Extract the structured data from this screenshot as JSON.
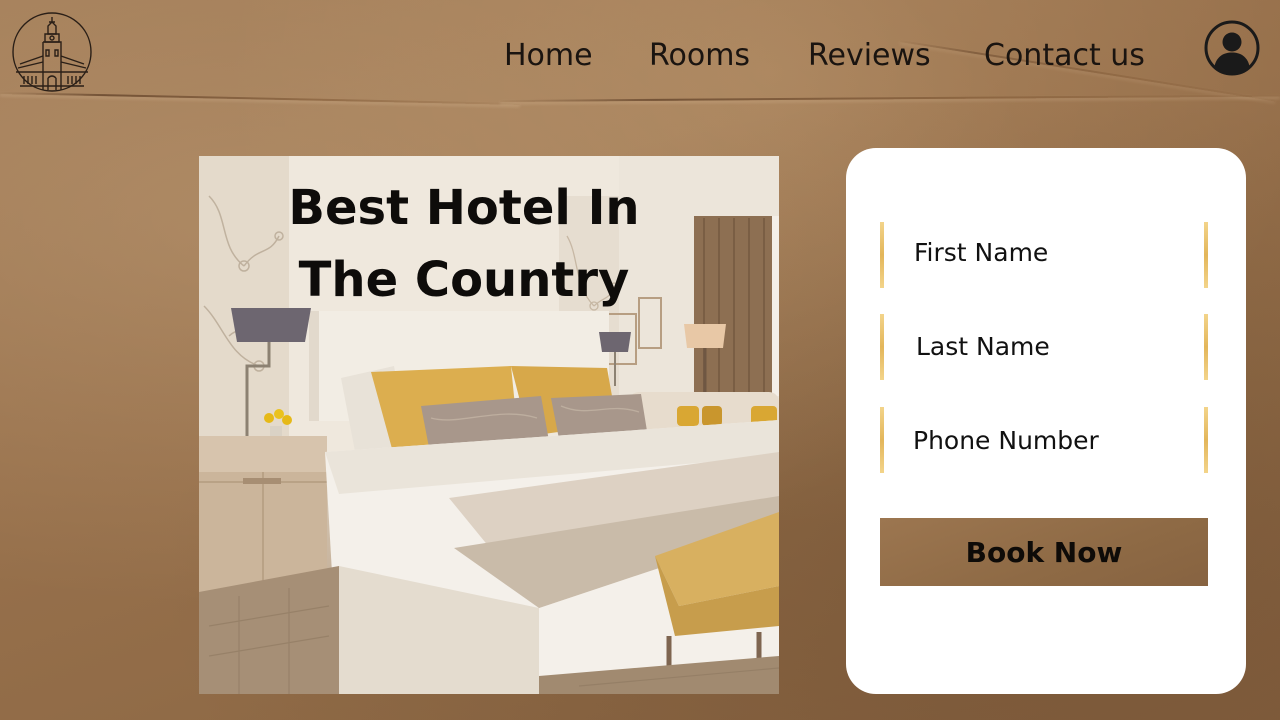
{
  "header": {
    "logo_icon": "hotel-building-logo",
    "nav": [
      {
        "label": "Home"
      },
      {
        "label": "Rooms"
      },
      {
        "label": "Reviews"
      },
      {
        "label": "Contact us"
      }
    ],
    "avatar_icon": "user-avatar-icon"
  },
  "hero": {
    "title_line1": "Best Hotel In",
    "title_line2": "The Country"
  },
  "booking_form": {
    "fields": [
      {
        "label": "First Name"
      },
      {
        "label": "Last Name"
      },
      {
        "label": "Phone Number"
      }
    ],
    "submit_label": "Book Now"
  },
  "colors": {
    "background": "#98714c",
    "card": "#ffffff",
    "accent_gold": "#e3b65a",
    "button": "#8e6a45",
    "text": "#1a1410"
  }
}
